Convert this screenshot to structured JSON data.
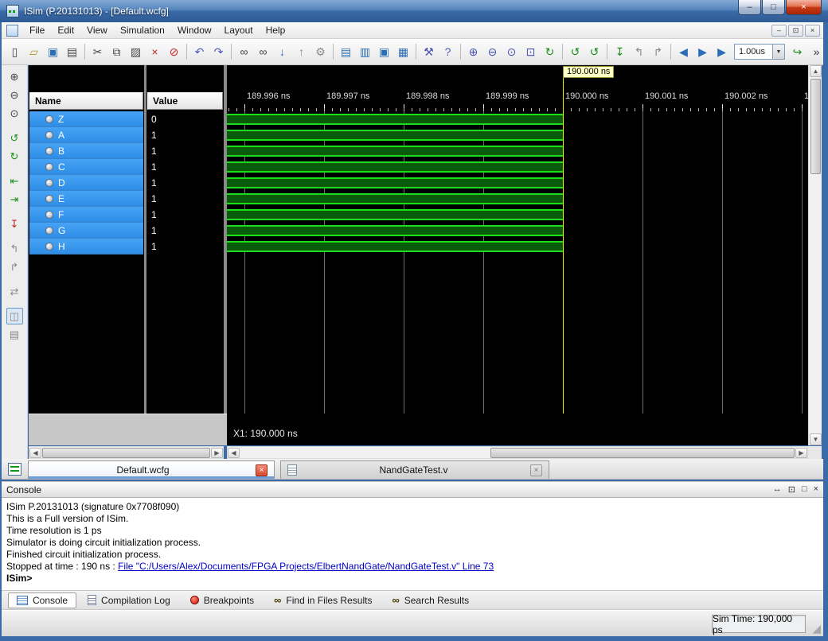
{
  "titlebar": {
    "title": "ISim (P.20131013) - [Default.wcfg]",
    "minimize_glyph": "–",
    "maximize_glyph": "□",
    "close_glyph": "×"
  },
  "menubar": {
    "items": [
      "File",
      "Edit",
      "View",
      "Simulation",
      "Window",
      "Layout",
      "Help"
    ],
    "mdi_minimize_glyph": "–",
    "mdi_restore_glyph": "⊡",
    "mdi_close_glyph": "×"
  },
  "toolbar": {
    "time_value": "1.00us",
    "dropdown_glyph": "▼",
    "overflow_glyph": "»",
    "icons": [
      {
        "name": "new-document-icon",
        "glyph": "▯"
      },
      {
        "name": "open-icon",
        "glyph": "▱"
      },
      {
        "name": "save-icon",
        "glyph": "▣"
      },
      {
        "name": "print-icon",
        "glyph": "▤"
      },
      {
        "name": "cut-icon",
        "glyph": "✂"
      },
      {
        "name": "copy-icon",
        "glyph": "⧉"
      },
      {
        "name": "paste-icon",
        "glyph": "▨"
      },
      {
        "name": "delete-icon",
        "glyph": "×"
      },
      {
        "name": "stop-icon",
        "glyph": "⊘"
      },
      {
        "name": "undo-icon",
        "glyph": "↶"
      },
      {
        "name": "redo-icon",
        "glyph": "↷"
      },
      {
        "name": "find-icon",
        "glyph": "∞"
      },
      {
        "name": "find-in-files-icon",
        "glyph": "∞"
      },
      {
        "name": "goto-next-icon",
        "glyph": "↓"
      },
      {
        "name": "goto-prev-icon",
        "glyph": "↑"
      },
      {
        "name": "settings-icon",
        "glyph": "⚙"
      },
      {
        "name": "tile-horizontal-icon",
        "glyph": "▤"
      },
      {
        "name": "tile-vertical-icon",
        "glyph": "▥"
      },
      {
        "name": "cascade-icon",
        "glyph": "▣"
      },
      {
        "name": "tile-grid-icon",
        "glyph": "▦"
      },
      {
        "name": "tools-icon",
        "glyph": "⚒"
      },
      {
        "name": "context-help-icon",
        "glyph": "?"
      },
      {
        "name": "zoom-in-icon",
        "glyph": "⊕"
      },
      {
        "name": "zoom-out-icon",
        "glyph": "⊖"
      },
      {
        "name": "zoom-full-icon",
        "glyph": "⊙"
      },
      {
        "name": "zoom-area-icon",
        "glyph": "⊡"
      },
      {
        "name": "refresh-icon",
        "glyph": "↻"
      },
      {
        "name": "relaunch-icon",
        "glyph": "↺"
      },
      {
        "name": "restart-icon",
        "glyph": "↺"
      },
      {
        "name": "step-icon",
        "glyph": "↧"
      },
      {
        "name": "undo-step-icon",
        "glyph": "↰"
      },
      {
        "name": "redo-step-icon",
        "glyph": "↱"
      },
      {
        "name": "goto-time-icon",
        "glyph": "◀"
      },
      {
        "name": "run-icon",
        "glyph": "▶"
      },
      {
        "name": "run-for-time-icon",
        "glyph": "▶"
      },
      {
        "name": "step-return-icon",
        "glyph": "↪"
      }
    ]
  },
  "left_toolbar": {
    "icons": [
      {
        "name": "zoom-in-icon",
        "glyph": "⊕"
      },
      {
        "name": "zoom-out-icon",
        "glyph": "⊖"
      },
      {
        "name": "zoom-full-icon",
        "glyph": "⊙"
      },
      {
        "name": "go-prev-event-icon",
        "glyph": "↺"
      },
      {
        "name": "go-next-event-icon",
        "glyph": "↻"
      },
      {
        "name": "prev-transition-icon",
        "glyph": "⇤"
      },
      {
        "name": "next-transition-icon",
        "glyph": "⇥"
      },
      {
        "name": "marker-icon",
        "glyph": "↧"
      },
      {
        "name": "prev-marker-icon",
        "glyph": "↰"
      },
      {
        "name": "next-marker-icon",
        "glyph": "↱"
      },
      {
        "name": "swap-cursors-icon",
        "glyph": "⇄"
      },
      {
        "name": "float-panel-icon",
        "glyph": "◫"
      },
      {
        "name": "ruler-icon",
        "glyph": "▤"
      }
    ]
  },
  "wave": {
    "name_header": "Name",
    "value_header": "Value",
    "signals": [
      {
        "name": "Z",
        "value": "0"
      },
      {
        "name": "A",
        "value": "1"
      },
      {
        "name": "B",
        "value": "1"
      },
      {
        "name": "C",
        "value": "1"
      },
      {
        "name": "D",
        "value": "1"
      },
      {
        "name": "E",
        "value": "1"
      },
      {
        "name": "F",
        "value": "1"
      },
      {
        "name": "G",
        "value": "1"
      },
      {
        "name": "H",
        "value": "1"
      }
    ],
    "time_ticks": [
      "189.996 ns",
      "189.997 ns",
      "189.998 ns",
      "189.999 ns",
      "190.000 ns",
      "190.001 ns",
      "190.002 ns",
      "1"
    ],
    "cursor_tooltip": "190.000 ns",
    "x1_label": "X1: 190.000 ns",
    "trace_edge_color": "#1ce01c",
    "trace_fill_color": "#0a5c0a",
    "cursor_color": "#f0f000",
    "selection_color": "#3399f3"
  },
  "tabs": [
    {
      "label": "Default.wcfg",
      "close_glyph": "×"
    },
    {
      "label": "NandGateTest.v",
      "close_glyph": "×"
    }
  ],
  "console": {
    "title": "Console",
    "dock_icons": [
      {
        "name": "resize-horizontal-icon",
        "glyph": "↔"
      },
      {
        "name": "restore-icon",
        "glyph": "⊡"
      },
      {
        "name": "float-icon",
        "glyph": "□"
      },
      {
        "name": "close-icon",
        "glyph": "×"
      }
    ],
    "lines": [
      "ISim P.20131013 (signature 0x7708f090)",
      "This is a Full version of ISim.",
      "Time resolution is 1 ps",
      "Simulator is doing circuit initialization process.",
      "Finished circuit initialization process."
    ],
    "stopped_prefix": "Stopped at time : 190 ns : ",
    "stopped_link": "File \"C:/Users/Alex/Documents/FPGA Projects/ElbertNandGate/NandGateTest.v\" Line 73",
    "prompt": "ISim>"
  },
  "bottom_tabs": [
    {
      "label": "Console"
    },
    {
      "label": "Compilation Log"
    },
    {
      "label": "Breakpoints"
    },
    {
      "label": "Find in Files Results"
    },
    {
      "label": "Search Results"
    }
  ],
  "statusbar": {
    "sim_time": "Sim Time: 190,000 ps"
  }
}
